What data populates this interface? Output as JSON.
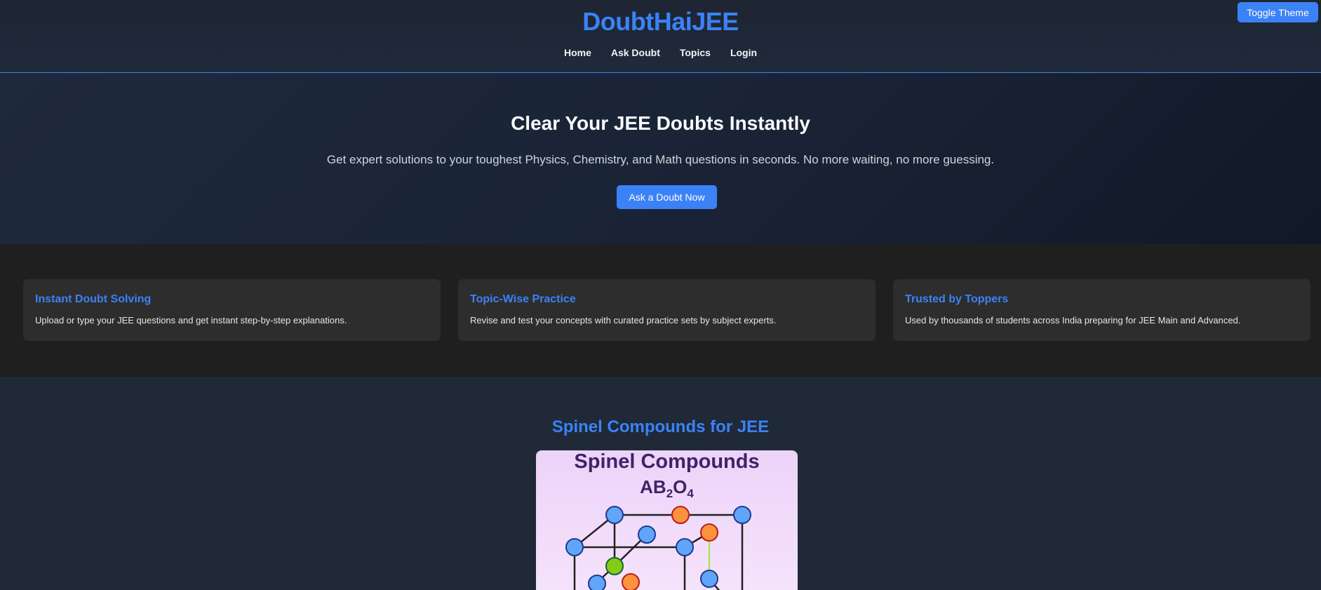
{
  "header": {
    "brand": "DoubtHaiJEE",
    "nav": [
      {
        "label": "Home"
      },
      {
        "label": "Ask Doubt"
      },
      {
        "label": "Topics"
      },
      {
        "label": "Login"
      }
    ],
    "toggle_label": "Toggle Theme"
  },
  "hero": {
    "title": "Clear Your JEE Doubts Instantly",
    "subtitle": "Get expert solutions to your toughest Physics, Chemistry, and Math questions in seconds. No more waiting, no more guessing.",
    "cta_label": "Ask a Doubt Now"
  },
  "features": [
    {
      "title": "Instant Doubt Solving",
      "text": "Upload or type your JEE questions and get instant step-by-step explanations."
    },
    {
      "title": "Topic-Wise Practice",
      "text": "Revise and test your concepts with curated practice sets by subject experts."
    },
    {
      "title": "Trusted by Toppers",
      "text": "Used by thousands of students across India preparing for JEE Main and Advanced."
    }
  ],
  "spinel": {
    "heading": "Spinel Compounds for JEE",
    "figure_title": "Spinel Compounds",
    "formula": {
      "a": "AB",
      "sub1": "2",
      "b": "O",
      "sub2": "4"
    }
  },
  "colors": {
    "accent": "#3b82f6",
    "atom_blue": "#60a5fa",
    "atom_orange": "#fb923c",
    "atom_green": "#84cc16"
  }
}
